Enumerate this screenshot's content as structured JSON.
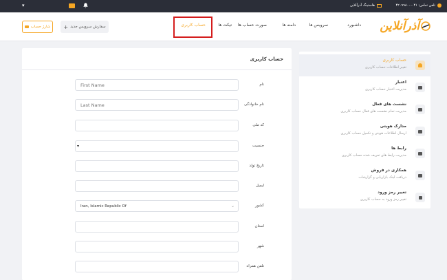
{
  "topbar": {
    "phone_label": "تلفن تماس: ۰۴۱-۴۲۰۹۹۸۰۰",
    "hosting_label": "هاستینگ آذرآنلاین"
  },
  "header": {
    "logo_text": "آذرآنلاین",
    "nav": [
      "داشبورد",
      "سرویس ها",
      "دامنه ها",
      "صورت حساب ها",
      "تیکت ها",
      "حساب کاربری"
    ],
    "order_button": "سفارش سرویس جدید",
    "cash_button": "شارژ حساب"
  },
  "sidebar": {
    "items": [
      {
        "title": "حساب کاربری",
        "sub": "تغییر اطلاعات حساب کاربری",
        "icon": "user-icon"
      },
      {
        "title": "اعتبار",
        "sub": "مدیریت اعتبار حساب کاربری",
        "icon": "wallet-icon"
      },
      {
        "title": "نشست های فعال",
        "sub": "مدیریت تمام نشست های فعال حساب کاربری",
        "icon": "sessions-icon"
      },
      {
        "title": "مدارک هویتی",
        "sub": "ارسال اطلاعات هویتی و تکمیل حساب کاربری",
        "icon": "id-card-icon"
      },
      {
        "title": "رابط ها",
        "sub": "مدیریت رابط های تعریف شده حساب کاربری",
        "icon": "contacts-icon"
      },
      {
        "title": "همکاری در فروش",
        "sub": "دریافت لینک بازاریابی و گزارشات",
        "icon": "handshake-icon"
      },
      {
        "title": "تغییر رمز ورود",
        "sub": "تغییر رمز ورود به حساب کاربری",
        "icon": "lock-icon"
      }
    ]
  },
  "form": {
    "title": "حساب کاربری",
    "fields": [
      {
        "label": "نام",
        "value": "",
        "placeholder": "First Name"
      },
      {
        "label": "نام خانوادگی",
        "value": "",
        "placeholder": "Last Name"
      },
      {
        "label": "کد ملی",
        "value": "",
        "placeholder": ""
      },
      {
        "label": "جنسیت",
        "value": "",
        "placeholder": ""
      },
      {
        "label": "تاریخ تولد",
        "value": "",
        "placeholder": ""
      },
      {
        "label": "ایمیل",
        "value": "",
        "placeholder": ""
      },
      {
        "label": "کشور",
        "value": "Iran, Islamic Republic Of",
        "placeholder": ""
      },
      {
        "label": "استان",
        "value": "",
        "placeholder": ""
      },
      {
        "label": "شهر",
        "value": "",
        "placeholder": ""
      },
      {
        "label": "تلفن همراه",
        "value": "",
        "placeholder": ""
      }
    ]
  },
  "colors": {
    "accent": "#f5a623",
    "topbar": "#2b2e38",
    "highlight": "#d41c1c"
  }
}
